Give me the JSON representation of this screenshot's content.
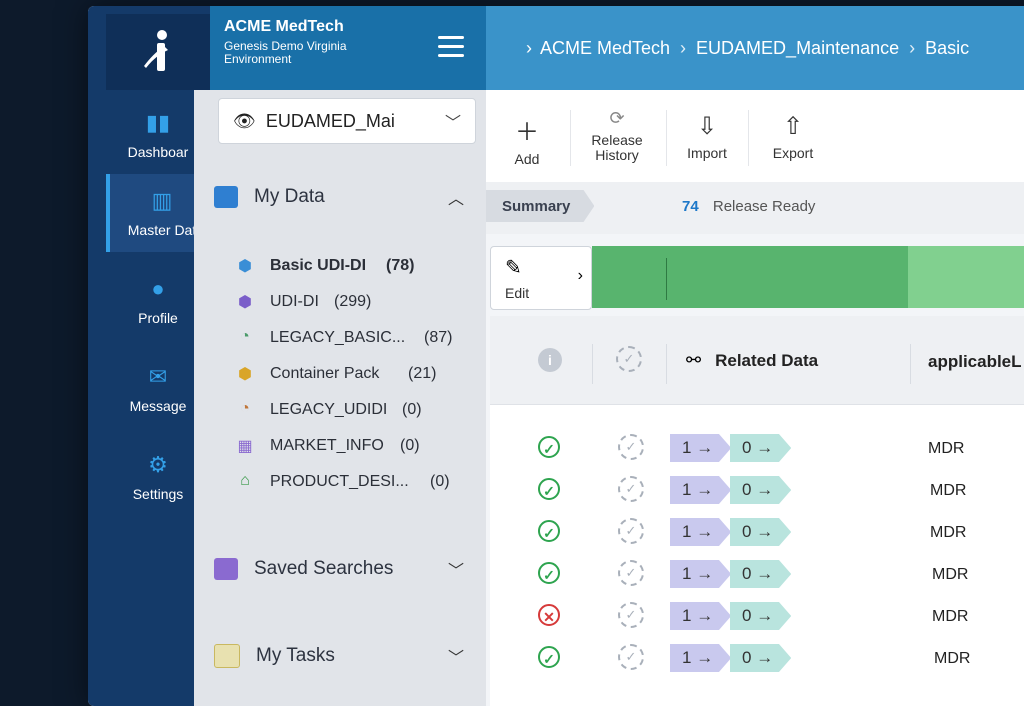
{
  "nav": {
    "items": [
      {
        "label": "Dashboar",
        "icon": "bar-chart-icon"
      },
      {
        "label": "Master Dat",
        "icon": "barcode-icon"
      },
      {
        "label": "Profile",
        "icon": "user-icon"
      },
      {
        "label": "Message",
        "icon": "envelope-icon"
      },
      {
        "label": "Settings",
        "icon": "gear-icon"
      }
    ]
  },
  "sidebar": {
    "company": "ACME MedTech",
    "environment": "Genesis Demo Virginia Environment",
    "dataset_select": "EUDAMED_Mai",
    "my_data": "My Data",
    "items": [
      {
        "label": "Basic UDI-DI",
        "count": "(78)"
      },
      {
        "label": "UDI-DI",
        "count": "(299)"
      },
      {
        "label": "LEGACY_BASIC...",
        "count": "(87)"
      },
      {
        "label": "Container Pack",
        "count": "(21)"
      },
      {
        "label": "LEGACY_UDIDI",
        "count": "(0)"
      },
      {
        "label": "MARKET_INFO",
        "count": "(0)"
      },
      {
        "label": "PRODUCT_DESI...",
        "count": "(0)"
      }
    ],
    "saved_searches": "Saved Searches",
    "my_tasks": "My Tasks"
  },
  "header": {
    "breadcrumb": [
      "ACME MedTech",
      "EUDAMED_Maintenance",
      "Basic"
    ]
  },
  "toolbar": {
    "add": "Add",
    "release_history": "Release History",
    "import": "Import",
    "export": "Export"
  },
  "summary": {
    "tab": "Summary",
    "release_count": "74",
    "release_label": "Release Ready"
  },
  "progress": {
    "edit_label": "Edit"
  },
  "table": {
    "col_related": "Related Data",
    "col_applicable": "applicableL",
    "rows": [
      {
        "status": "ok",
        "a": "1",
        "b": "0",
        "regulation": "MDR"
      },
      {
        "status": "ok",
        "a": "1",
        "b": "0",
        "regulation": "MDR"
      },
      {
        "status": "ok",
        "a": "1",
        "b": "0",
        "regulation": "MDR"
      },
      {
        "status": "ok",
        "a": "1",
        "b": "0",
        "regulation": "MDR"
      },
      {
        "status": "error",
        "a": "1",
        "b": "0",
        "regulation": "MDR"
      },
      {
        "status": "ok",
        "a": "1",
        "b": "0",
        "regulation": "MDR"
      }
    ]
  },
  "colors": {
    "nav_bg": "#143a69",
    "header_blue": "#3a93c9",
    "progress_dark": "#58b46e",
    "progress_light": "#81d08f",
    "ok": "#2ea44f",
    "error": "#d63a3a"
  }
}
